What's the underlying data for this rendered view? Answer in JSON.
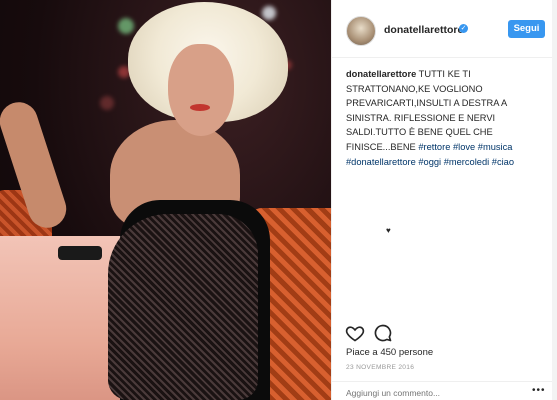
{
  "post": {
    "username": "donatellarettore",
    "verified_symbol": "✓",
    "follow_label": "Segui",
    "caption": {
      "author": "donatellarettore",
      "lines": [
        " TUTTI KE TI",
        "STRATTONANO,KE VOGLIONO",
        "PREVARICARTI,INSULTI A DESTRA A",
        "SINISTRA. RIFLESSIONE E NERVI",
        "SALDI.TUTTO È BENE QUEL CHE",
        "FINISCE...BENE "
      ],
      "hashtags_line6": [
        "#rettore",
        "#love",
        "#musica"
      ],
      "hashtags_line7": [
        "#donatellarettore",
        "#oggi",
        "#mercoledi",
        "#ciao"
      ]
    },
    "heart_glyph": "♥",
    "likes_text": "Piace a 450 persone",
    "date_text": "23 NOVEMBRE 2016",
    "comment_placeholder": "Aggiungi un commento...",
    "more_glyph": "•••"
  },
  "colors": {
    "follow_bg": "#3897f0",
    "hashtag": "#003569",
    "muted": "#999999"
  },
  "icons": [
    "heart-icon",
    "comment-icon",
    "verified-badge-icon",
    "more-options-icon"
  ]
}
